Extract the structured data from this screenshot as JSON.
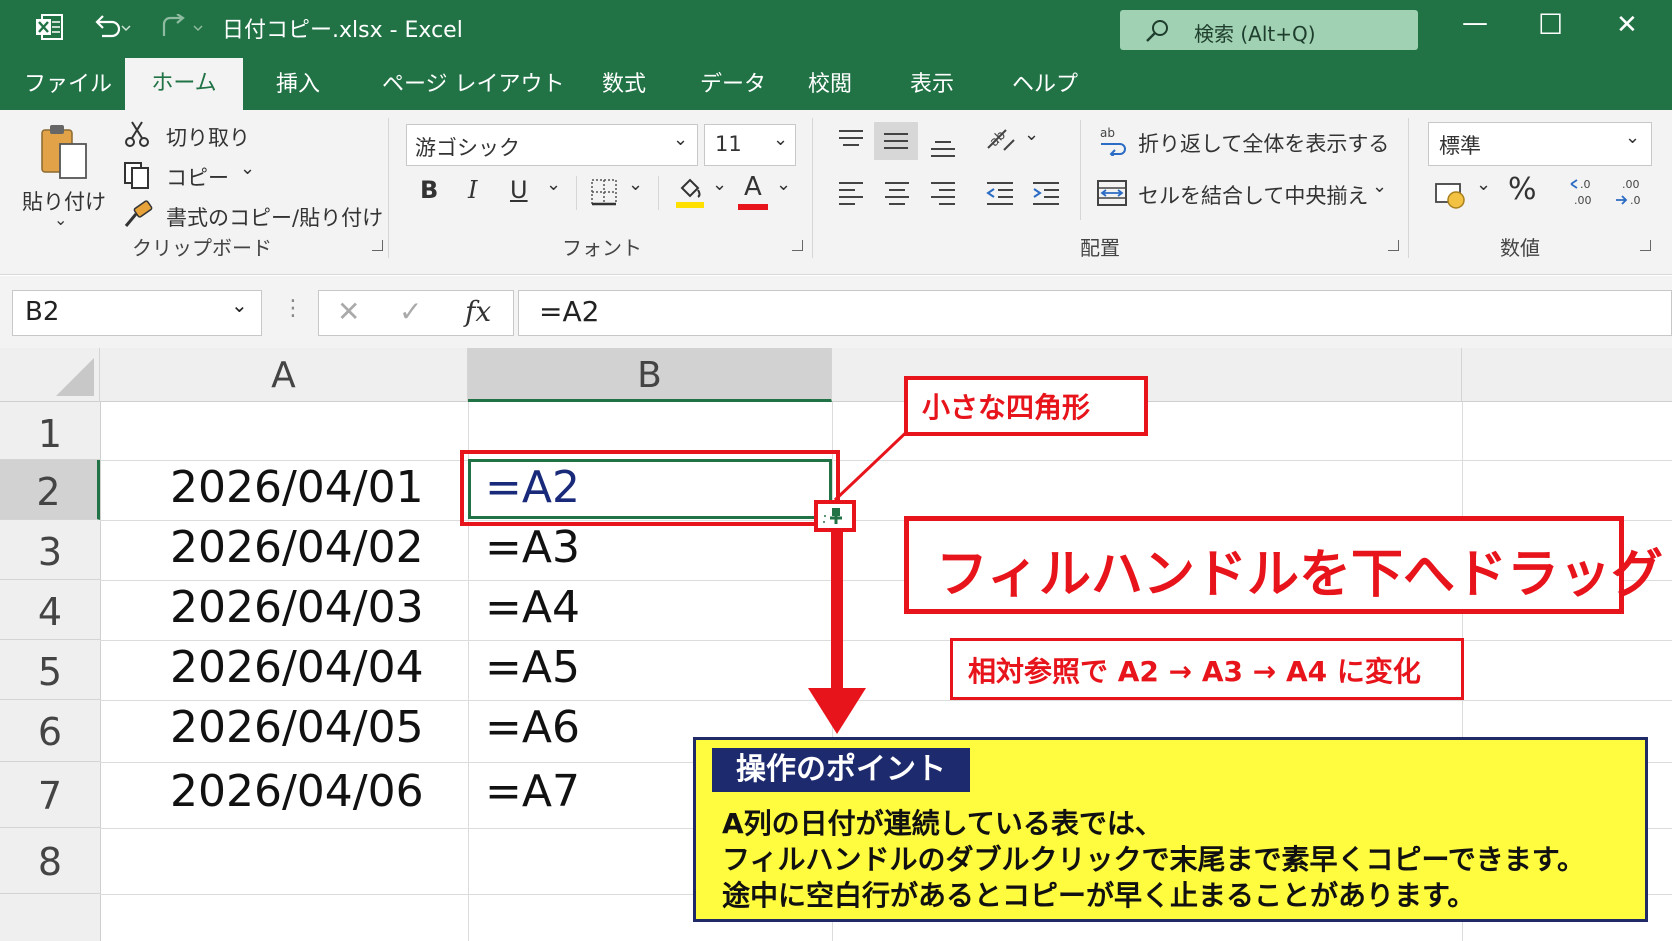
{
  "window": {
    "title": "日付コピー.xlsx  -  Excel",
    "search_label": "検索 (Alt+Q)",
    "minimize": "—",
    "maximize": "☐",
    "close": "✕"
  },
  "tabs": [
    "ファイル",
    "ホーム",
    "挿入",
    "ページ レイアウト",
    "数式",
    "データ",
    "校閲",
    "表示",
    "ヘルプ"
  ],
  "ribbon": {
    "clipboard": {
      "paste": "貼り付け",
      "cut": "切り取り",
      "copy": "コピー",
      "format_painter": "書式のコピー/貼り付け",
      "group_label": "クリップボード"
    },
    "font": {
      "font_name": "游ゴシック",
      "font_size": "11",
      "bold": "B",
      "italic": "I",
      "underline": "U",
      "font_color_glyph": "A",
      "group_label": "フォント"
    },
    "alignment": {
      "wrap_text": "折り返して全体を表示する",
      "merge_center": "セルを結合して中央揃え",
      "group_label": "配置"
    },
    "number": {
      "format": "標準",
      "percent": "%",
      "group_label": "数値"
    }
  },
  "formula_bar": {
    "name_box": "B2",
    "fx": "fx",
    "formula": "=A2"
  },
  "sheet": {
    "columns": [
      "A",
      "B"
    ],
    "rows": [
      "1",
      "2",
      "3",
      "4",
      "5",
      "6",
      "7",
      "8"
    ],
    "cells_A": [
      "",
      "2026/04/01",
      "2026/04/02",
      "2026/04/03",
      "2026/04/04",
      "2026/04/05",
      "2026/04/06",
      ""
    ],
    "cells_B": [
      "",
      "=A2",
      "=A3",
      "=A4",
      "=A5",
      "=A6",
      "=A7",
      ""
    ],
    "selected_cell": "B2"
  },
  "annotations": {
    "small_square": "小さな四角形",
    "drag_down": "フィルハンドルを下へドラッグ",
    "relative_ref": "相対参照で A2 → A3 → A4 に変化",
    "point_title": "操作のポイント",
    "point_lines": [
      "A列の日付が連続している表では、",
      "フィルハンドルのダブルクリックで末尾まで素早くコピーできます。",
      "途中に空白行があるとコピーが早く止まることがあります。"
    ]
  },
  "colors": {
    "excel_green": "#217346",
    "annotation_red": "#e8141b",
    "note_yellow": "#fffb3f",
    "note_navy": "#1d2a6e"
  }
}
